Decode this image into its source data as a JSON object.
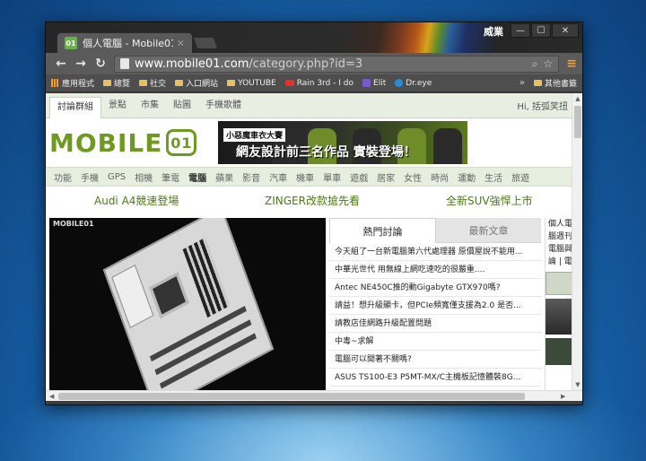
{
  "browser": {
    "tab_title": "個人電腦 - Mobile01",
    "tab_favicon": "01",
    "user_label": "威業",
    "url_host": "www.mobile01.com",
    "url_path": "/category.php?id=3",
    "window_buttons": {
      "minimize": "—",
      "maximize": "☐",
      "close": "✕"
    }
  },
  "bookmarks": [
    {
      "label": "應用程式",
      "icon": "apps-icon"
    },
    {
      "label": "總覽",
      "icon": "folder-icon"
    },
    {
      "label": "社交",
      "icon": "folder-icon"
    },
    {
      "label": "入口網站",
      "icon": "folder-icon"
    },
    {
      "label": "YOUTUBE",
      "icon": "folder-icon"
    },
    {
      "label": "Rain 3rd - I do",
      "icon": "youtube-icon"
    },
    {
      "label": "Elit",
      "icon": "elit-icon"
    },
    {
      "label": "Dr.eye",
      "icon": "dreye-icon"
    }
  ],
  "bookmarks_more": "»",
  "bookmarks_other": "其他書籤",
  "site": {
    "topnav": [
      "討論群組",
      "景點",
      "市集",
      "貼圖",
      "手機歌體"
    ],
    "greeting": "Hi, 括弧笑扭",
    "logo_text": "MOBILE",
    "logo_mark": "01",
    "banner_small": "小惡魔車衣大賽",
    "banner_big": "網友設計前三名作品 實裝登場！",
    "categories": [
      "功能",
      "手機",
      "GPS",
      "相機",
      "筆電",
      "電腦",
      "蘋果",
      "影音",
      "汽車",
      "機車",
      "單車",
      "遊戲",
      "居家",
      "女性",
      "時尚",
      "運動",
      "生活",
      "旅遊"
    ],
    "active_category": "電腦",
    "promos": [
      "Audi A4競速登場",
      "ZINGER改款搶先看",
      "全新SUV強悍上市"
    ],
    "hero_logo": "MOBILE01",
    "forum_tabs": [
      "熱門討論",
      "最新文章"
    ],
    "forum_items": [
      "今天組了一台新電腦第六代處理器 原價屋說不能用...",
      "中華光世代 用無線上網吃速吃的很嚴重....",
      "Antec NE450C推的動Gigabyte GTX970嗎?",
      "請益！想升級顯卡，但PCIe頻寬僅支援為2.0 是否...",
      "請教店佳網路升級配置問題",
      "中毒~求解",
      "電腦可以開著不關嗎?",
      "ASUS TS100-E3 P5MT-MX/C主機板記憶體裝8G..."
    ],
    "side_text": [
      "個人電",
      "腦週刊",
      "電腦與",
      "論 | 電"
    ]
  },
  "colors": {
    "accent_green": "#6f9a22",
    "promo_green": "#4d7a18",
    "chrome_dark": "#3c3c3c"
  }
}
